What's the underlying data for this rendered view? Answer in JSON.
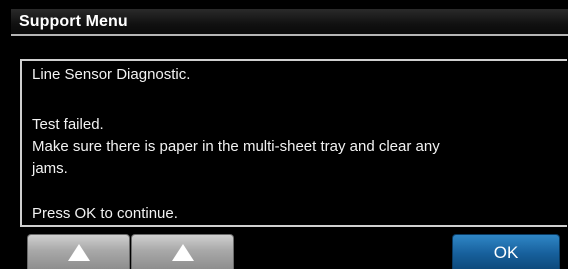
{
  "title": "Support Menu",
  "message": {
    "lines": [
      "Line Sensor Diagnostic.",
      "",
      "Test failed.",
      "Make sure there is paper in the multi-sheet tray and clear any",
      "jams.",
      "",
      "Press OK to continue."
    ]
  },
  "buttons": {
    "up_icon": "up-arrow-icon",
    "second_icon": "up-arrow-icon",
    "ok_label": "OK",
    "ok_color": "#1b6aa8"
  }
}
